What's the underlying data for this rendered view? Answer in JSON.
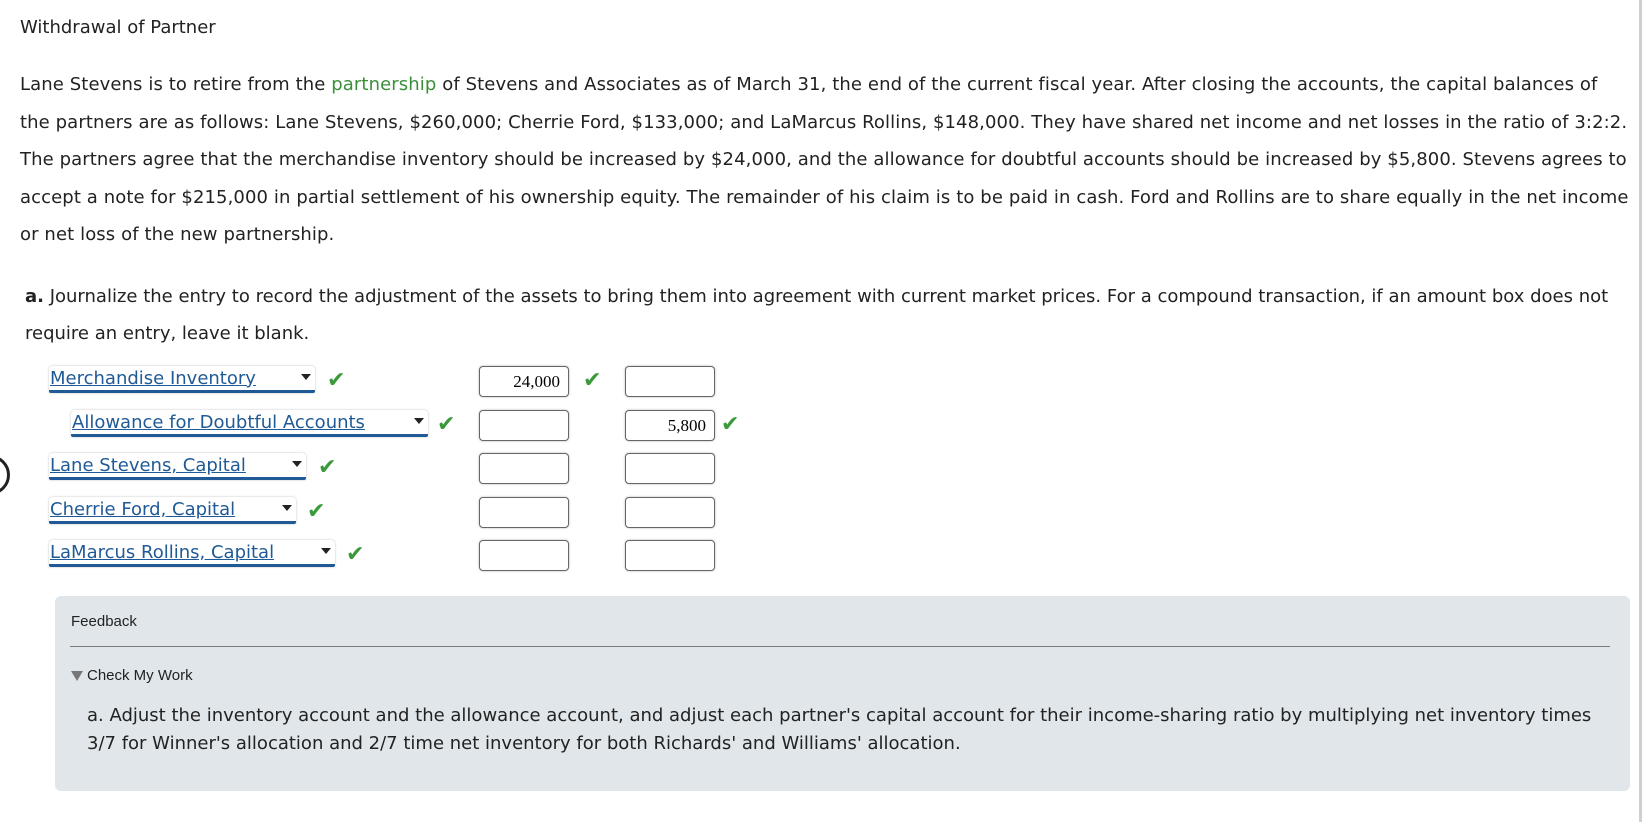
{
  "title": "Withdrawal of Partner",
  "problem": {
    "before_link": "Lane Stevens is to retire from the ",
    "link": "partnership",
    "after_link": " of Stevens and Associates as of March 31, the end of the current fiscal year. After closing the accounts, the capital balances of the partners are as follows: Lane Stevens, $260,000; Cherrie Ford, $133,000; and LaMarcus Rollins, $148,000. They have shared net income and net losses in the ratio of 3:2:2. The partners agree that the merchandise inventory should be increased by $24,000, and the allowance for doubtful accounts should be increased by $5,800. Stevens agrees to accept a note for $215,000 in partial settlement of his ownership equity. The remainder of his claim is to be paid in cash. Ford and Rollins are to share equally in the net income or net loss of the new partnership."
  },
  "question": {
    "label": "a.",
    "text": " Journalize the entry to record the adjustment of the assets to bring them into agreement with current market prices. For a compound transaction, if an amount box does not require an entry, leave it blank."
  },
  "journal": {
    "rows": [
      {
        "account": "Merchandise Inventory",
        "debit": "24,000",
        "credit": "",
        "account_correct": true,
        "debit_correct": true,
        "credit_correct": false
      },
      {
        "account": "Allowance for Doubtful Accounts",
        "debit": "",
        "credit": "5,800",
        "account_correct": true,
        "debit_correct": false,
        "credit_correct": true
      },
      {
        "account": "Lane Stevens, Capital",
        "debit": "",
        "credit": "",
        "account_correct": true
      },
      {
        "account": "Cherrie Ford, Capital",
        "debit": "",
        "credit": "",
        "account_correct": true
      },
      {
        "account": "LaMarcus Rollins, Capital",
        "debit": "",
        "credit": "",
        "account_correct": true
      }
    ],
    "check_glyph": "✔"
  },
  "feedback": {
    "label": "Feedback",
    "toggle_label": "Check My Work",
    "text": "a. Adjust the inventory account and the allowance account, and adjust each partner's capital account for their income-sharing ratio by multiplying net inventory times 3/7 for Winner's allocation and 2/7 time net inventory for both Richards' and Williams' allocation."
  },
  "colors": {
    "link": "#3b8f3b",
    "select": "#1f5a96",
    "check": "#3a9a3a",
    "feedback_bg": "#e0e6ea"
  }
}
